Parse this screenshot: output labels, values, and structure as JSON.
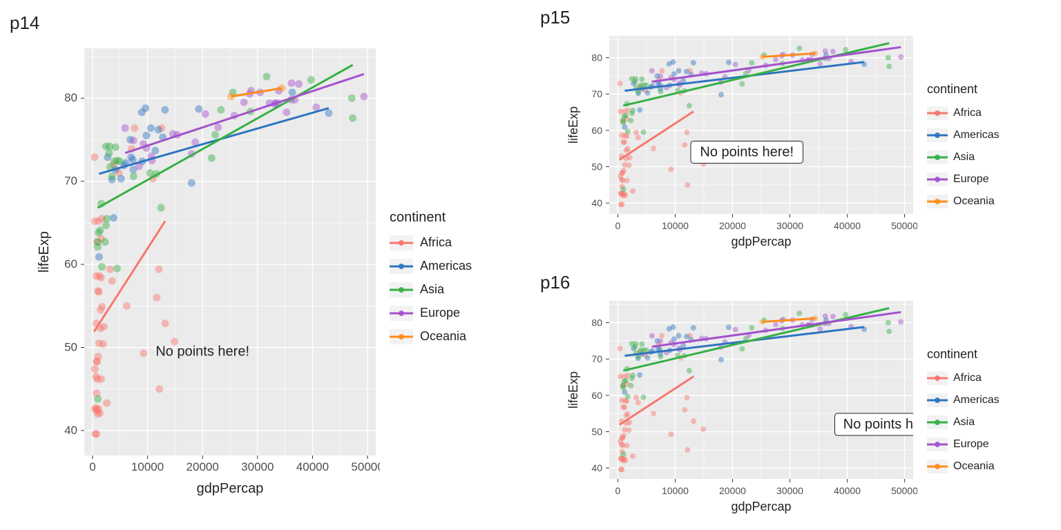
{
  "colors": {
    "Africa": "#F8766D",
    "Americas": "#2E74C0",
    "Asia": "#35B044",
    "Europe": "#A352CC",
    "Oceania": "#FF8C1A"
  },
  "legend": {
    "title": "continent",
    "items": [
      "Africa",
      "Americas",
      "Asia",
      "Europe",
      "Oceania"
    ]
  },
  "axes": {
    "xlabel": "gdpPercap",
    "ylabel": "lifeExp",
    "x_ticks": [
      0,
      10000,
      20000,
      30000,
      40000,
      50000
    ],
    "y_ticks": [
      40,
      50,
      60,
      70,
      80
    ],
    "y_minor": [
      45,
      55,
      65,
      75,
      85
    ],
    "x_minor": [
      5000,
      15000,
      25000,
      35000,
      45000
    ],
    "xlim": [
      -1500,
      51500
    ],
    "ylim": [
      37,
      86
    ]
  },
  "panels": {
    "p14": {
      "title": "p14",
      "annotation_box": false,
      "annotation": "No points here!",
      "annotation_xy": [
        20000,
        49
      ]
    },
    "p15": {
      "title": "p15",
      "annotation_box": true,
      "annotation": "No points here!",
      "annotation_xy": [
        22500,
        54
      ]
    },
    "p16": {
      "title": "p16",
      "annotation_box": true,
      "annotation": "No points her",
      "annotation_xy": [
        40000,
        52
      ],
      "clipped": true
    }
  },
  "chart_data": {
    "type": "scatter",
    "xlabel": "gdpPercap",
    "ylabel": "lifeExp",
    "xlim": [
      -1500,
      51500
    ],
    "ylim": [
      37,
      86
    ],
    "annotations": [
      "No points here!"
    ],
    "series": [
      {
        "name": "Africa",
        "points": [
          [
            469,
            42.6
          ],
          [
            527,
            39.6
          ],
          [
            1156,
            56.7
          ],
          [
            14906,
            50.7
          ],
          [
            1037,
            48.9
          ],
          [
            430,
            47.4
          ],
          [
            1934,
            50.4
          ],
          [
            1193,
            50.5
          ],
          [
            739,
            44.5
          ],
          [
            1704,
            54.9
          ],
          [
            974,
            56.8
          ],
          [
            673,
            52.9
          ],
          [
            795,
            48.3
          ],
          [
            2602,
            43.3
          ],
          [
            6223,
            55.0
          ],
          [
            1441,
            52.3
          ],
          [
            3548,
            58.0
          ],
          [
            12057,
            59.4
          ],
          [
            641,
            46.5
          ],
          [
            690,
            58.6
          ],
          [
            13206,
            52.9
          ],
          [
            1328,
            42.1
          ],
          [
            633,
            42.7
          ],
          [
            4797,
            71.0
          ],
          [
            1463,
            54.5
          ],
          [
            759,
            48.3
          ],
          [
            9270,
            49.3
          ],
          [
            706,
            39.6
          ],
          [
            926,
            42.0
          ],
          [
            823,
            62.7
          ],
          [
            1107,
            65.2
          ],
          [
            12570,
            76.4
          ],
          [
            1569,
            46.2
          ],
          [
            7670,
            76.4
          ],
          [
            863,
            46.2
          ],
          [
            1598,
            63.1
          ],
          [
            1712,
            65.5
          ],
          [
            1077,
            42.6
          ],
          [
            3820,
            72.0
          ],
          [
            7093,
            73.9
          ],
          [
            11666,
            56.0
          ],
          [
            1545,
            58.4
          ],
          [
            2042,
            52.5
          ],
          [
            379,
            72.9
          ],
          [
            3190,
            59.4
          ],
          [
            1271,
            58.6
          ],
          [
            10957,
            70.3
          ],
          [
            443,
            65.2
          ],
          [
            12154,
            45.0
          ],
          [
            785,
            42.4
          ]
        ],
        "fit": {
          "x1": 277,
          "y1": 51.9,
          "x2": 13207,
          "y2": 65.2
        }
      },
      {
        "name": "Americas",
        "points": [
          [
            12779,
            75.3
          ],
          [
            3822,
            65.6
          ],
          [
            9066,
            72.4
          ],
          [
            36319,
            80.7
          ],
          [
            13172,
            78.6
          ],
          [
            7007,
            72.9
          ],
          [
            9645,
            78.8
          ],
          [
            8948,
            78.3
          ],
          [
            6025,
            72.2
          ],
          [
            6873,
            75.0
          ],
          [
            5728,
            71.9
          ],
          [
            5186,
            70.3
          ],
          [
            1202,
            60.9
          ],
          [
            3548,
            70.2
          ],
          [
            7321,
            72.6
          ],
          [
            11978,
            76.2
          ],
          [
            2749,
            72.9
          ],
          [
            9809,
            75.5
          ],
          [
            4172,
            71.4
          ],
          [
            7409,
            71.4
          ],
          [
            19329,
            78.7
          ],
          [
            18009,
            69.8
          ],
          [
            42952,
            78.2
          ],
          [
            10611,
            76.4
          ],
          [
            11416,
            73.7
          ]
        ],
        "fit": {
          "x1": 1202,
          "y1": 70.9,
          "x2": 42952,
          "y2": 78.8
        }
      },
      {
        "name": "Asia",
        "points": [
          [
            974,
            43.8
          ],
          [
            1391,
            64.1
          ],
          [
            1714,
            59.7
          ],
          [
            4959,
            72.4
          ],
          [
            944,
            62.7
          ],
          [
            39725,
            82.2
          ],
          [
            2452,
            64.7
          ],
          [
            3541,
            70.6
          ],
          [
            11606,
            70.9
          ],
          [
            4471,
            59.5
          ],
          [
            25523,
            80.7
          ],
          [
            31656,
            82.6
          ],
          [
            4519,
            72.5
          ],
          [
            1593,
            67.3
          ],
          [
            23348,
            78.6
          ],
          [
            47307,
            77.6
          ],
          [
            10461,
            71.0
          ],
          [
            3096,
            74.2
          ],
          [
            12451,
            66.8
          ],
          [
            944,
            62.1
          ],
          [
            1091,
            63.8
          ],
          [
            22316,
            75.6
          ],
          [
            2606,
            65.5
          ],
          [
            3190,
            71.7
          ],
          [
            21655,
            72.8
          ],
          [
            47143,
            80.0
          ],
          [
            3970,
            72.4
          ],
          [
            4184,
            74.1
          ],
          [
            28718,
            78.4
          ],
          [
            7458,
            70.6
          ],
          [
            2442,
            74.2
          ],
          [
            3025,
            73.4
          ],
          [
            2281,
            62.7
          ]
        ],
        "fit": {
          "x1": 944,
          "y1": 66.8,
          "x2": 47307,
          "y2": 84.0
        }
      },
      {
        "name": "Europe",
        "points": [
          [
            5937,
            76.4
          ],
          [
            36126,
            79.8
          ],
          [
            33693,
            79.4
          ],
          [
            7446,
            74.9
          ],
          [
            10681,
            73.0
          ],
          [
            14619,
            75.7
          ],
          [
            22833,
            76.5
          ],
          [
            35278,
            78.3
          ],
          [
            33207,
            79.3
          ],
          [
            30470,
            80.7
          ],
          [
            32170,
            79.4
          ],
          [
            27538,
            79.5
          ],
          [
            18009,
            73.3
          ],
          [
            36181,
            81.8
          ],
          [
            40676,
            78.9
          ],
          [
            28570,
            80.5
          ],
          [
            9254,
            74.5
          ],
          [
            36798,
            79.8
          ],
          [
            49357,
            80.2
          ],
          [
            15390,
            75.6
          ],
          [
            20510,
            78.1
          ],
          [
            10808,
            72.5
          ],
          [
            9787,
            74.0
          ],
          [
            18678,
            74.7
          ],
          [
            25768,
            77.9
          ],
          [
            28821,
            80.9
          ],
          [
            33860,
            80.9
          ],
          [
            37506,
            81.7
          ],
          [
            8458,
            71.8
          ],
          [
            33203,
            79.4
          ]
        ],
        "fit": {
          "x1": 5937,
          "y1": 73.4,
          "x2": 49357,
          "y2": 82.9
        }
      },
      {
        "name": "Oceania",
        "points": [
          [
            34435,
            81.2
          ],
          [
            25185,
            80.2
          ]
        ],
        "fit": {
          "x1": 25185,
          "y1": 80.2,
          "x2": 34435,
          "y2": 81.2
        }
      }
    ]
  }
}
